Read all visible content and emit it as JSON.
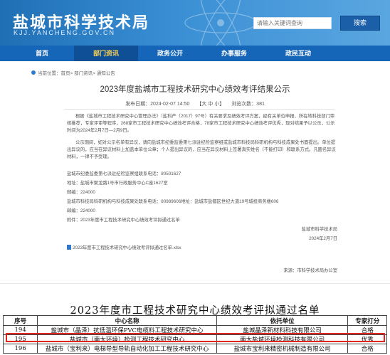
{
  "header": {
    "site_title": "盐城市科学技术局",
    "site_subtitle": "KJJ.YANCHENG.GOV.CN",
    "search_placeholder": "请输入关键词查询",
    "search_button": "搜索"
  },
  "nav": {
    "items": [
      {
        "label": "首页",
        "active": false
      },
      {
        "label": "部门资讯",
        "active": true
      },
      {
        "label": "政务公开",
        "active": false
      },
      {
        "label": "办事服务",
        "active": false
      },
      {
        "label": "政民互动",
        "active": false
      }
    ]
  },
  "breadcrumb": {
    "text": "当前位置：首页> 部门资讯> 通知公告"
  },
  "article": {
    "title": "2023年度盐城市工程技术研究中心绩效考评结果公示",
    "publish_time": "发布日期：2024-02-07 14:50",
    "font_size": "【大 中 小】",
    "views": "浏览次数：381",
    "p1": "根据《盐城市工程技术研究中心管理办法》（盐科产〔2017〕97号）有关要求及绩效考评方案，经有关单位申报、所在地科技部门审核推荐，专家评审等程序，268家市工程技术研究中心绩效考评合格，78家市工程技术研究中心绩效考评优秀，现对结果予以公示，公示时间为2024年2月7日—2月9日。",
    "p2": "公示期间，如对公示名单有异议，请向盐城市纪委监委第七派驻纪检监察组或盐城市科技局科研机构与科技成果处书面提出。单位提出异议的，应当在异议材料上加盖本单位公章；个人提出异议的，应当在异议材料上签署真实姓名（不能打印）和联系方式。凡匿名异议材料，一律不予受理。",
    "c1": "盐城市纪委监委第七派驻纪检监察组联系电话：80501627",
    "c2": "地址：盐城市聚龙路1号市行政服务中心C座1627室",
    "c3": "邮编：224000",
    "c4": "盐城市科技局科研机构与科技成果处联系电话：80989606地址：盐城市盐都区世纪大道19号城投商务楼606",
    "c5": "邮编：224000",
    "attachment_note": "附件：2023年度市工程技术研究中心绩效考评拟通过名单",
    "sign_org": "盐城市科学技术局",
    "sign_date": "2024年2月7日",
    "attachment_file": "2023年度市工程技术研究中心绩效考评拟通过名单.xlsx",
    "source": "来源：市科学技术局办公室"
  },
  "table": {
    "title": "2023年度市工程技术研究中心绩效考评拟通过名单",
    "headers": [
      "序号",
      "中心名称",
      "依托单位",
      "专家打分"
    ],
    "rows": [
      [
        "194",
        "盐城市（晶泽）抗低温环保PVC电缆料工程技术研究中心",
        "盐城晶泽新材料科技有限公司",
        "合格"
      ],
      [
        "195",
        "盐城市（南大环境）检测工程技术研究中心",
        "南大盐城环境检测科技有限公司",
        "优秀"
      ],
      [
        "196",
        "盐城市（宝利来）电梯导型导轨自动化加工工程技术研究中心",
        "盐城市宝利来精密机械制造有限公司",
        "合格"
      ]
    ],
    "highlight_color": "#e2261f"
  },
  "colors": {
    "banner": "#1f6fb5",
    "nav": "#1565b8",
    "nav_active_text": "#ffd34d"
  }
}
